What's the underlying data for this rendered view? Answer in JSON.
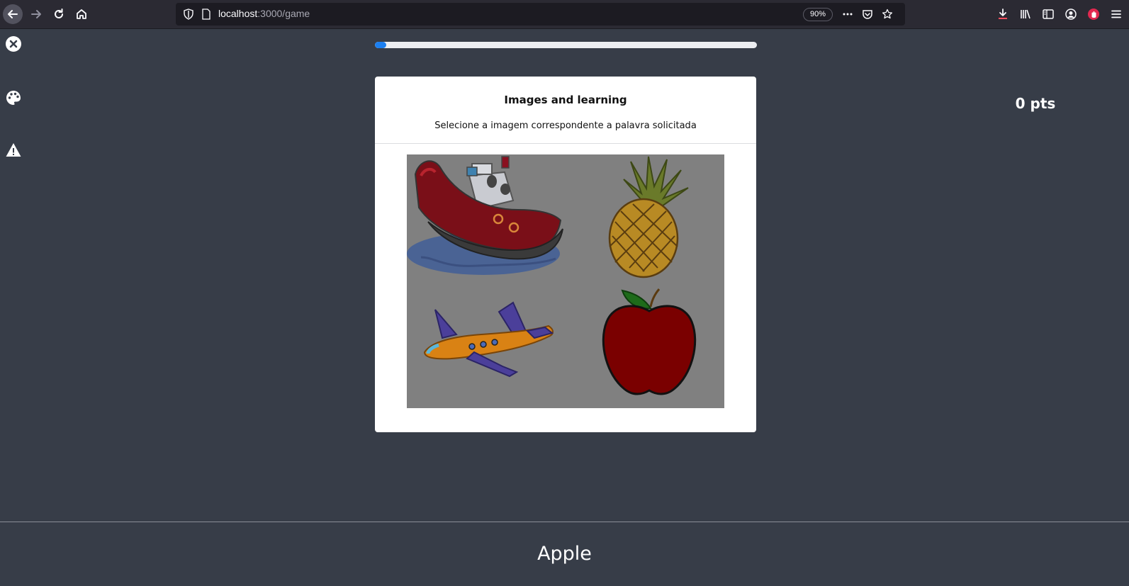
{
  "browser": {
    "url_host": "localhost",
    "url_path": ":3000/game",
    "zoom": "90%",
    "icons": [
      "back-arrow-icon",
      "forward-arrow-icon",
      "reload-icon",
      "home-icon",
      "shield-icon",
      "page-icon",
      "more-icon",
      "pocket-icon",
      "star-icon",
      "download-icon",
      "library-icon",
      "sidebar-icon",
      "account-icon",
      "addon-icon",
      "menu-icon"
    ]
  },
  "sidebar": {
    "icons": [
      "close-circle-icon",
      "palette-icon",
      "warning-icon"
    ]
  },
  "progress": {
    "fraction": 0.03,
    "color": "#1b7ff0"
  },
  "score": {
    "text": "0 pts"
  },
  "card": {
    "title": "Images and learning",
    "subtitle": "Selecione a imagem correspondente a palavra solicitada",
    "options": [
      "boat",
      "pineapple",
      "airplane",
      "apple"
    ]
  },
  "target_word": "Apple",
  "colors": {
    "background": "#373d48",
    "card": "#ffffff",
    "overlay": "#808080"
  }
}
